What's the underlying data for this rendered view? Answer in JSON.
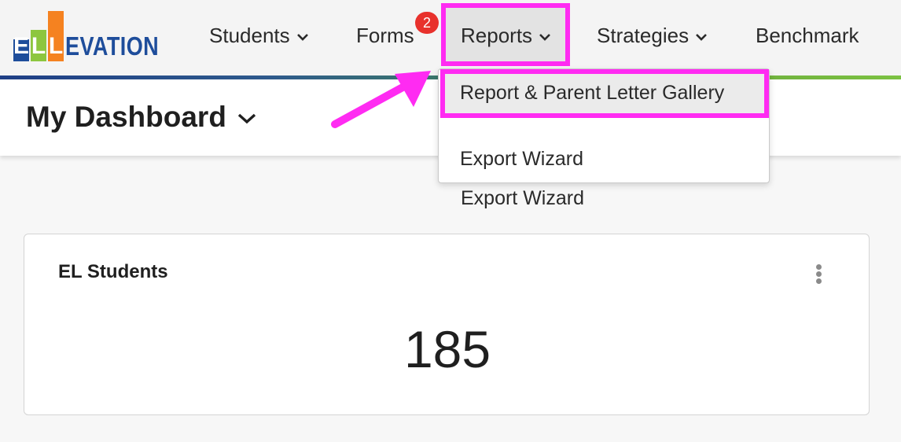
{
  "brand": {
    "logo_letters": [
      "E",
      "L",
      "L"
    ],
    "logo_word": "EVATION",
    "colors": {
      "blue": "#1e4d9b",
      "green": "#8dc63f",
      "orange": "#f58220",
      "highlight": "#ff2bf2",
      "badge": "#e8312c"
    }
  },
  "nav": {
    "items": [
      {
        "label": "Students",
        "has_dropdown": true
      },
      {
        "label": "Forms",
        "has_dropdown": false
      },
      {
        "label": "Reports",
        "has_dropdown": true
      },
      {
        "label": "Strategies",
        "has_dropdown": true
      },
      {
        "label": "Benchmark",
        "has_dropdown": false
      }
    ],
    "forms_badge": "2"
  },
  "reports_menu": {
    "items": [
      {
        "label": "Report & Parent Letter Gallery"
      },
      {
        "label": "Export Wizard"
      }
    ]
  },
  "dashboard": {
    "title": "My Dashboard"
  },
  "card": {
    "title": "EL Students",
    "value": "185",
    "menu_icon": "kebab-icon"
  }
}
